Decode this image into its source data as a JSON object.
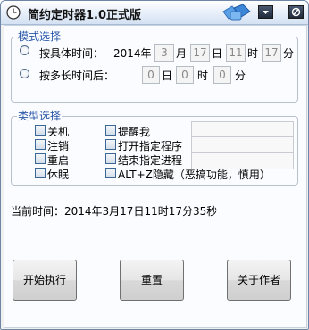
{
  "window": {
    "title": "简约定时器1.0正式版"
  },
  "mode_group": {
    "legend": "模式选择",
    "specific": {
      "label": "按具体时间：",
      "year": "2014年",
      "month_value": "3",
      "month_unit": "月",
      "day_value": "17",
      "day_unit": "日",
      "hour_value": "11",
      "hour_unit": "时",
      "minute_value": "17",
      "minute_unit": "分"
    },
    "delay": {
      "label": "按多长时间后：",
      "day_value": "0",
      "day_unit": "日",
      "hour_value": "0",
      "hour_unit": "时",
      "minute_value": "0",
      "minute_unit": "分"
    }
  },
  "type_group": {
    "legend": "类型选择",
    "col1": [
      "关机",
      "注销",
      "重启",
      "休眠"
    ],
    "col2": [
      "提醒我",
      "打开指定程序",
      "结束指定进程",
      "ALT+Z隐藏（恶搞功能，慎用）"
    ]
  },
  "current_time": "当前时间：2014年3月17日11时17分35秒",
  "buttons": {
    "start": "开始执行",
    "reset": "重置",
    "about": "关于作者"
  }
}
